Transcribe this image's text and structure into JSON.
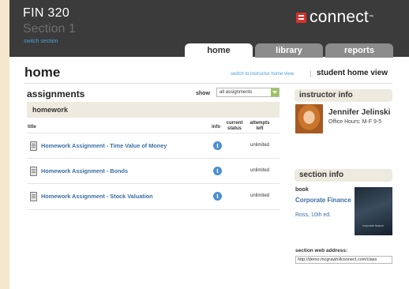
{
  "header": {
    "course_title": "FIN 320",
    "course_section": "Section 1",
    "switch_section": "switch section",
    "logo_text": "connect",
    "logo_tm": "™",
    "tabs": [
      {
        "label": "home",
        "active": true
      },
      {
        "label": "library",
        "active": false
      },
      {
        "label": "reports",
        "active": false
      }
    ]
  },
  "page": {
    "title": "home",
    "switch_instructor": "switch to instructor home view",
    "separator": "|",
    "student_view": "student home view"
  },
  "assignments": {
    "title": "assignments",
    "show_label": "show",
    "show_value": "all assignments",
    "category": "homework",
    "columns": {
      "title": "title",
      "info": "info",
      "status": "current status",
      "attempts": "attempts left"
    },
    "rows": [
      {
        "title": "Homework Assignment - Time Value of Money",
        "info_glyph": "i",
        "attempts": "unlimited"
      },
      {
        "title": "Homework Assignment - Bonds",
        "info_glyph": "i",
        "attempts": "unlimited"
      },
      {
        "title": "Homework Assignment - Stock Valuation",
        "info_glyph": "i",
        "attempts": "unlimited"
      }
    ]
  },
  "instructor": {
    "panel_title": "instructor info",
    "name": "Jennifer Jelinski",
    "office_hours": "Office Hours: M-F 9-5"
  },
  "section_info": {
    "panel_title": "section info",
    "book_label": "book",
    "book_title": "Corporate Finance",
    "book_edition": "Ross, 10th ed.",
    "book_cover_text": "corporate finance",
    "web_address_label": "section web address:",
    "web_address_value": "http://demo.mcgrawhillconnect.com/class"
  },
  "colors": {
    "header_bg": "#3b3b3b",
    "accent_red": "#d9312b",
    "link_blue": "#3a6ea5",
    "panel_tan": "#eeeadf",
    "page_bg": "#f4e6cd"
  }
}
